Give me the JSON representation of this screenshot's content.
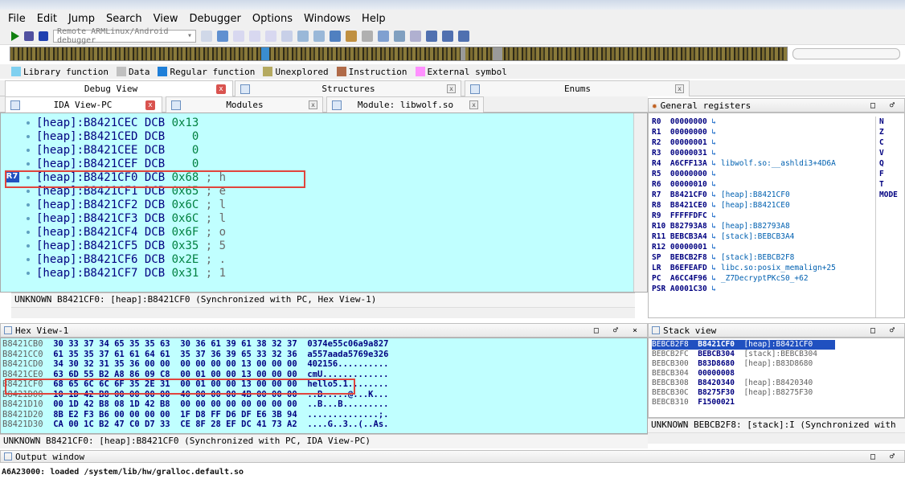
{
  "menu": [
    "File",
    "Edit",
    "Jump",
    "Search",
    "View",
    "Debugger",
    "Options",
    "Windows",
    "Help"
  ],
  "toolbar": {
    "debugger_select": "Remote ARMLinux/Android debugger"
  },
  "legend": [
    {
      "label": "Library function",
      "color": "#7fd0f0"
    },
    {
      "label": "Data",
      "color": "#c0c0c0"
    },
    {
      "label": "Regular function",
      "color": "#1f7fd8"
    },
    {
      "label": "Unexplored",
      "color": "#b5aa60"
    },
    {
      "label": "Instruction",
      "color": "#b06a48"
    },
    {
      "label": "External symbol",
      "color": "#ff90ff"
    }
  ],
  "tabs_top": [
    "Debug View",
    "Structures",
    "Enums"
  ],
  "tabs_second": [
    "IDA View-PC",
    "Modules",
    "Module: libwolf.so"
  ],
  "ida": {
    "lines": [
      {
        "addr": "[heap]:B8421CEC",
        "op": "DCB",
        "val": "0x13",
        "cm": ""
      },
      {
        "addr": "[heap]:B8421CED",
        "op": "DCB",
        "val": "   0",
        "cm": ""
      },
      {
        "addr": "[heap]:B8421CEE",
        "op": "DCB",
        "val": "   0",
        "cm": ""
      },
      {
        "addr": "[heap]:B8421CEF",
        "op": "DCB",
        "val": "   0",
        "cm": ""
      },
      {
        "addr": "[heap]:B8421CF0",
        "op": "DCB",
        "val": "0x68",
        "cm": " ; h"
      },
      {
        "addr": "[heap]:B8421CF1",
        "op": "DCB",
        "val": "0x65",
        "cm": " ; e"
      },
      {
        "addr": "[heap]:B8421CF2",
        "op": "DCB",
        "val": "0x6C",
        "cm": " ; l"
      },
      {
        "addr": "[heap]:B8421CF3",
        "op": "DCB",
        "val": "0x6C",
        "cm": " ; l"
      },
      {
        "addr": "[heap]:B8421CF4",
        "op": "DCB",
        "val": "0x6F",
        "cm": " ; o"
      },
      {
        "addr": "[heap]:B8421CF5",
        "op": "DCB",
        "val": "0x35",
        "cm": " ; 5"
      },
      {
        "addr": "[heap]:B8421CF6",
        "op": "DCB",
        "val": "0x2E",
        "cm": " ; ."
      },
      {
        "addr": "[heap]:B8421CF7",
        "op": "DCB",
        "val": "0x31",
        "cm": " ; 1"
      }
    ],
    "r7_tag": "R7",
    "status": "UNKNOWN B8421CF0: [heap]:B8421CF0 (Synchronized with PC, Hex View-1)"
  },
  "registers": {
    "title": "General registers",
    "rows": [
      {
        "n": "R0 ",
        "v": "00000000",
        "r": ""
      },
      {
        "n": "R1 ",
        "v": "00000000",
        "r": ""
      },
      {
        "n": "R2 ",
        "v": "00000001",
        "r": ""
      },
      {
        "n": "R3 ",
        "v": "00000031",
        "r": ""
      },
      {
        "n": "R4 ",
        "v": "A6CFF13A",
        "r": "libwolf.so:__ashldi3+4D6A"
      },
      {
        "n": "R5 ",
        "v": "00000000",
        "r": ""
      },
      {
        "n": "R6 ",
        "v": "00000010",
        "r": ""
      },
      {
        "n": "R7 ",
        "v": "B8421CF0",
        "r": "[heap]:B8421CF0"
      },
      {
        "n": "R8 ",
        "v": "B8421CE0",
        "r": "[heap]:B8421CE0"
      },
      {
        "n": "R9 ",
        "v": "FFFFFDFC",
        "r": ""
      },
      {
        "n": "R10",
        "v": "B82793A8",
        "r": "[heap]:B82793A8"
      },
      {
        "n": "R11",
        "v": "BEBCB3A4",
        "r": "[stack]:BEBCB3A4"
      },
      {
        "n": "R12",
        "v": "00000001",
        "r": ""
      },
      {
        "n": "SP ",
        "v": "BEBCB2F8",
        "r": "[stack]:BEBCB2F8"
      },
      {
        "n": "LR ",
        "v": "B6EFEAFD",
        "r": "libc.so:posix_memalign+25"
      },
      {
        "n": "PC ",
        "v": "A6CC4F96",
        "r": "_Z7DecryptPKcS0_+62"
      },
      {
        "n": "PSR",
        "v": "A0001C30",
        "r": ""
      }
    ],
    "flags": [
      "N",
      "Z",
      "C",
      "V",
      "Q",
      "F",
      "T",
      "MODE"
    ]
  },
  "hex": {
    "title": "Hex View-1",
    "lines": [
      {
        "addr": "B8421CB0",
        "bytes": "30 33 37 34 65 35 35 63  30 36 61 39 61 38 32 37",
        "ascii": "0374e55c06a9a827"
      },
      {
        "addr": "B8421CC0",
        "bytes": "61 35 35 37 61 61 64 61  35 37 36 39 65 33 32 36",
        "ascii": "a557aada5769e326"
      },
      {
        "addr": "B8421CD0",
        "bytes": "34 30 32 31 35 36 00 00  00 00 00 00 13 00 00 00",
        "ascii": "402156.........."
      },
      {
        "addr": "B8421CE0",
        "bytes": "63 6D 55 B2 A8 86 09 C8  00 01 00 00 13 00 00 00",
        "ascii": "cmU............."
      },
      {
        "addr": "B8421CF0",
        "bytes": "68 65 6C 6C 6F 35 2E 31  00 01 00 00 13 00 00 00",
        "ascii": "hello5.1........"
      },
      {
        "addr": "B8421D00",
        "bytes": "10 1D 42 B8 00 00 00 00  40 00 00 00 4B 00 00 00",
        "ascii": "..B.....@...K..."
      },
      {
        "addr": "B8421D10",
        "bytes": "00 1D 42 B8 08 1D 42 B8  00 00 00 00 00 00 00 00",
        "ascii": "..B...B........."
      },
      {
        "addr": "B8421D20",
        "bytes": "8B E2 F3 B6 00 00 00 00  1F D8 FF D6 DF E6 3B 94",
        "ascii": "..............;."
      },
      {
        "addr": "B8421D30",
        "bytes": "CA 00 1C B2 47 C0 D7 33  CE 8F 28 EF DC 41 73 A2",
        "ascii": "....G..3..(..As."
      }
    ],
    "status": "UNKNOWN B8421CF0: [heap]:B8421CF0 (Synchronized with PC, IDA View-PC)"
  },
  "stack": {
    "title": "Stack view",
    "lines": [
      {
        "a": "BEBCB2F8",
        "v": "B8421CF0",
        "r": "[heap]:B8421CF0"
      },
      {
        "a": "BEBCB2FC",
        "v": "BEBCB304",
        "r": "[stack]:BEBCB304"
      },
      {
        "a": "BEBCB300",
        "v": "B83D8680",
        "r": "[heap]:B83D8680"
      },
      {
        "a": "BEBCB304",
        "v": "00000008",
        "r": ""
      },
      {
        "a": "BEBCB308",
        "v": "B8420340",
        "r": "[heap]:B8420340"
      },
      {
        "a": "BEBCB30C",
        "v": "B8275F30",
        "r": "[heap]:B8275F30"
      },
      {
        "a": "BEBCB310",
        "v": "F1500021",
        "r": ""
      }
    ],
    "status": "UNKNOWN BEBCB2F8: [stack]:I (Synchronized with"
  },
  "output": {
    "title": "Output window",
    "lines": [
      "A6A23000: loaded /system/lib/hw/gralloc.default.so"
    ]
  }
}
